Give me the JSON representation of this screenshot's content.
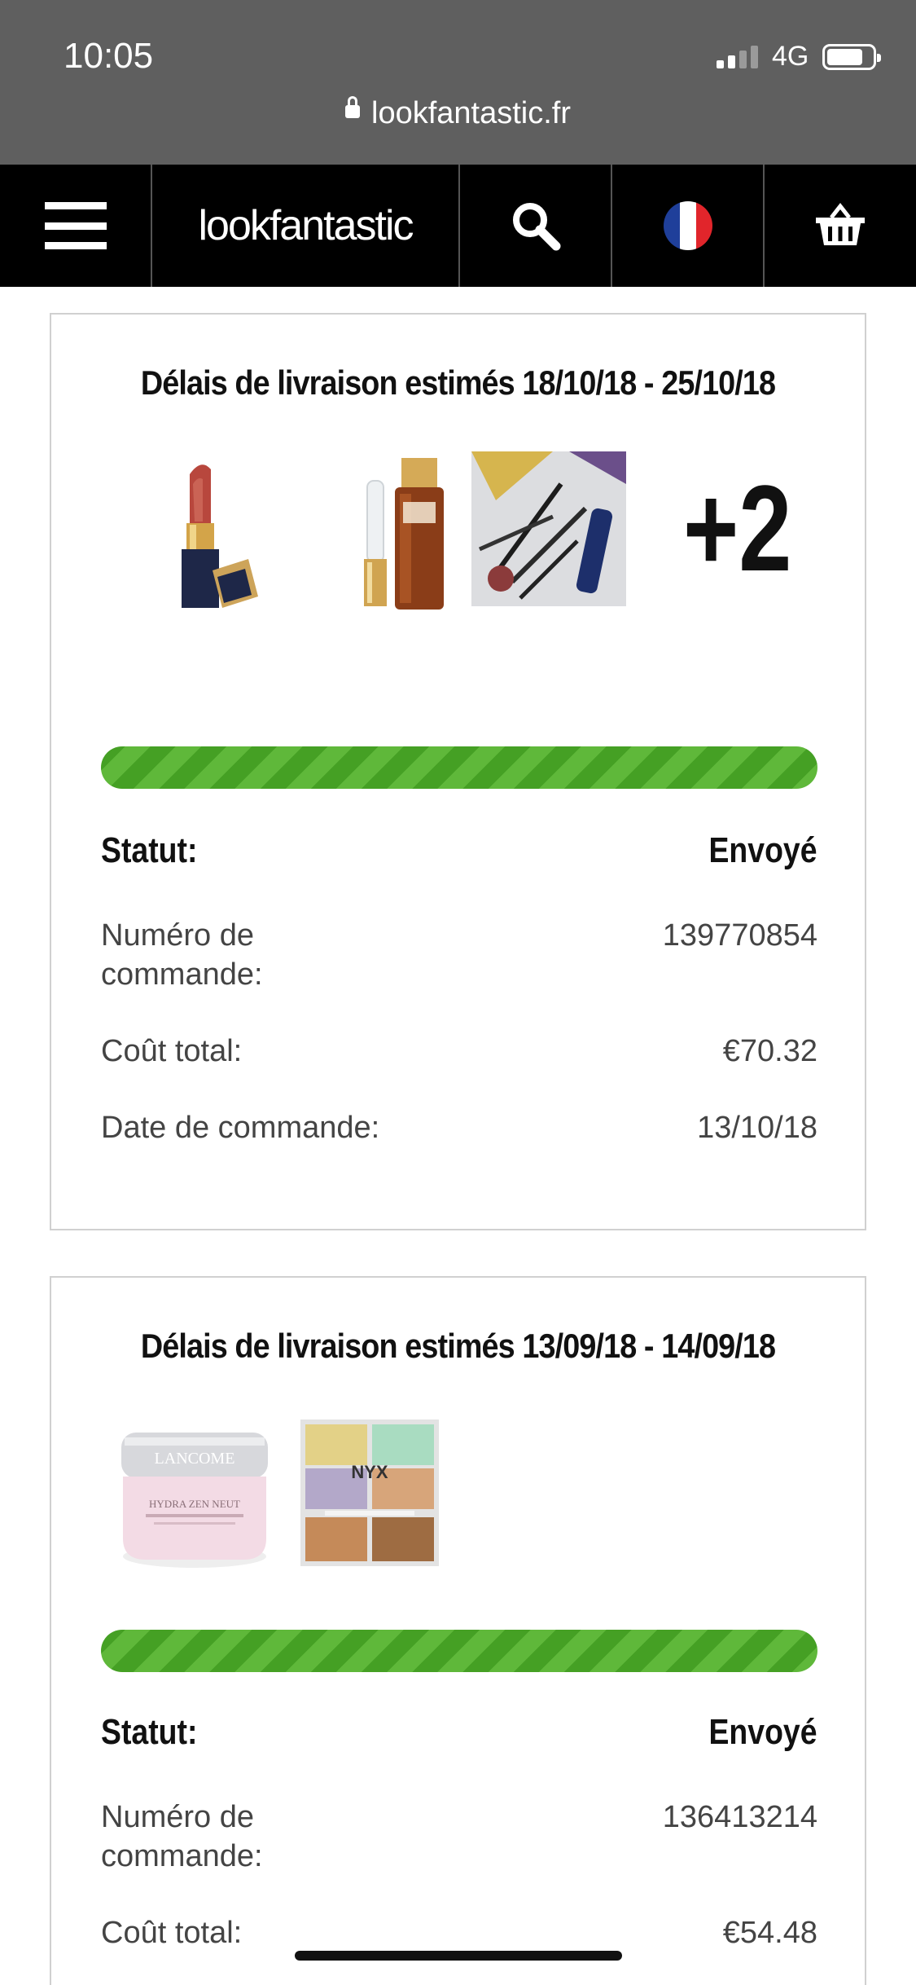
{
  "status_bar": {
    "time": "10:05",
    "network": "4G"
  },
  "browser": {
    "url": "lookfantastic.fr"
  },
  "header": {
    "logo_text": "lookfantastic",
    "flag_colors": [
      "#1f3f9a",
      "#ffffff",
      "#e1252b"
    ]
  },
  "orders": [
    {
      "title": "Délais de livraison estimés 18/10/18 - 25/10/18",
      "more_count": "+2",
      "progress": 1.0,
      "status_label": "Statut:",
      "status_value": "Envoyé",
      "order_number_label": "Numéro de commande:",
      "order_number": "139770854",
      "total_label": "Coût total:",
      "total": "€70.32",
      "date_label": "Date de commande:",
      "date": "13/10/18",
      "thumbnails": [
        "lipstick",
        "eye-serum",
        "makeup-brushes-set"
      ]
    },
    {
      "title": "Délais de livraison estimés 13/09/18 - 14/09/18",
      "progress": 1.0,
      "status_label": "Statut:",
      "status_value": "Envoyé",
      "order_number_label": "Numéro de commande:",
      "order_number": "136413214",
      "total_label": "Coût total:",
      "total": "€54.48",
      "thumbnails": [
        "face-cream-jar",
        "color-correcting-palette"
      ],
      "thumbnail_text": {
        "cream_brand": "LANCOME",
        "cream_name": "HYDRA ZEN NEUT",
        "palette_brand": "NYX"
      }
    }
  ],
  "accent_color": "#5fb83a"
}
